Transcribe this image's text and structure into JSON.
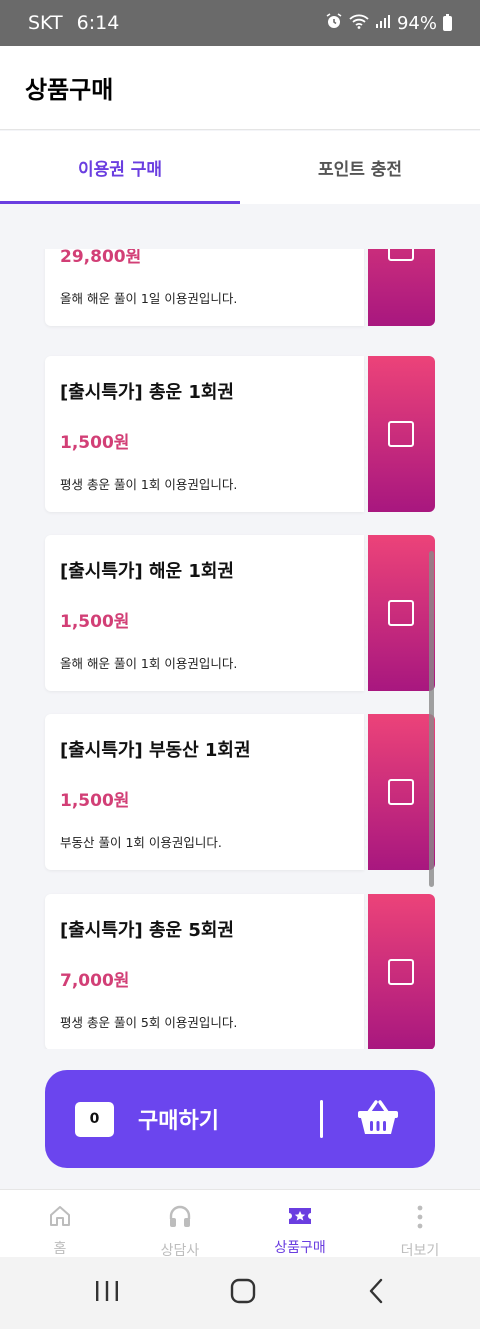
{
  "status": {
    "carrier": "SKT",
    "time": "6:14",
    "battery": "94%",
    "icons": [
      "alarm-icon",
      "wifi-icon",
      "signal-icon",
      "battery-icon"
    ]
  },
  "header": {
    "title": "상품구매"
  },
  "tabs": [
    {
      "label": "이용권 구매",
      "active": true
    },
    {
      "label": "포인트 충전",
      "active": false
    }
  ],
  "products": [
    {
      "title": "",
      "price": "29,800원",
      "description": "올해 해운 풀이 1일 이용권입니다."
    },
    {
      "title": "[출시특가] 총운 1회권",
      "price": "1,500원",
      "description": "평생 총운 풀이 1회 이용권입니다."
    },
    {
      "title": "[출시특가] 해운 1회권",
      "price": "1,500원",
      "description": "올해 해운 풀이 1회 이용권입니다."
    },
    {
      "title": "[출시특가] 부동산 1회권",
      "price": "1,500원",
      "description": "부동산 풀이 1회 이용권입니다."
    },
    {
      "title": "[출시특가] 총운 5회권",
      "price": "7,000원",
      "description": "평생 총운 풀이 5회 이용권입니다."
    }
  ],
  "purchase": {
    "count": "0",
    "label": "구매하기",
    "icon": "basket-icon"
  },
  "bottom_nav": [
    {
      "label": "홈",
      "icon": "home-icon",
      "active": false
    },
    {
      "label": "상담사",
      "icon": "headset-icon",
      "active": false
    },
    {
      "label": "상품구매",
      "icon": "ticket-star-icon",
      "active": true
    },
    {
      "label": "더보기",
      "icon": "more-icon",
      "active": false
    }
  ],
  "colors": {
    "accent": "#6a3ee0",
    "price": "#d23f76",
    "buy_bar": "#6b45ee",
    "stub_top": "#ec4379",
    "stub_bottom": "#a8177f"
  }
}
